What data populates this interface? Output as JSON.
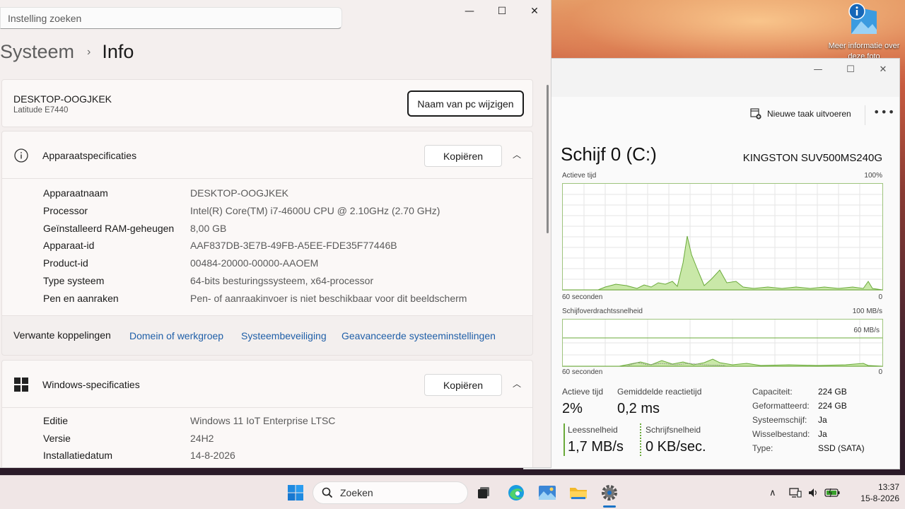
{
  "desktop": {
    "icon_label": "Meer informatie over deze foto"
  },
  "settings": {
    "search_placeholder": "Instelling zoeken",
    "breadcrumb_parent": "Systeem",
    "breadcrumb_current": "Info",
    "pc_name": "DESKTOP-OOGJKEK",
    "pc_model": "Latitude E7440",
    "rename_button": "Naam van pc wijzigen",
    "device_specs": {
      "title": "Apparaatspecificaties",
      "copy_button": "Kopiëren",
      "rows": [
        {
          "key": "Apparaatnaam",
          "value": "DESKTOP-OOGJKEK"
        },
        {
          "key": "Processor",
          "value": "Intel(R) Core(TM) i7-4600U CPU @ 2.10GHz (2.70 GHz)"
        },
        {
          "key": "Geïnstalleerd RAM-geheugen",
          "value": "8,00 GB"
        },
        {
          "key": "Apparaat-id",
          "value": "AAF837DB-3E7B-49FB-A5EE-FDE35F77446B"
        },
        {
          "key": "Product-id",
          "value": "00484-20000-00000-AAOEM"
        },
        {
          "key": "Type systeem",
          "value": "64-bits besturingssysteem, x64-processor"
        },
        {
          "key": "Pen en aanraken",
          "value": "Pen- of aanraakinvoer is niet beschikbaar voor dit beeldscherm"
        }
      ]
    },
    "related": {
      "label": "Verwante koppelingen",
      "links": [
        "Domein of werkgroep",
        "Systeembeveiliging",
        "Geavanceerde systeeminstellingen"
      ]
    },
    "windows_specs": {
      "title": "Windows-specificaties",
      "copy_button": "Kopiëren",
      "rows": [
        {
          "key": "Editie",
          "value": "Windows 11 IoT Enterprise LTSC"
        },
        {
          "key": "Versie",
          "value": "24H2"
        },
        {
          "key": "Installatiedatum",
          "value": "14-8-2026"
        }
      ]
    }
  },
  "taskmanager": {
    "new_task": "Nieuwe taak uitvoeren",
    "disk_title": "Schijf 0 (C:)",
    "model": "KINGSTON SUV500MS240G",
    "graph1": {
      "label": "Actieve tijd",
      "max": "100%",
      "xlabel": "60 seconden",
      "min": "0"
    },
    "graph2": {
      "label": "Schijfoverdrachtssnelheid",
      "max": "100 MB/s",
      "mid": "60 MB/s",
      "xlabel": "60 seconden",
      "min": "0"
    },
    "stats": {
      "active_label": "Actieve tijd",
      "active_value": "2%",
      "resp_label": "Gemiddelde reactietijd",
      "resp_value": "0,2 ms",
      "read_label": "Leessnelheid",
      "read_value": "1,7 MB/s",
      "write_label": "Schrijfsnelheid",
      "write_value": "0 KB/sec."
    },
    "props": [
      {
        "key": "Capaciteit:",
        "value": "224 GB"
      },
      {
        "key": "Geformatteerd:",
        "value": "224 GB"
      },
      {
        "key": "Systeemschijf:",
        "value": "Ja"
      },
      {
        "key": "Wisselbestand:",
        "value": "Ja"
      },
      {
        "key": "Type:",
        "value": "SSD (SATA)"
      }
    ]
  },
  "taskbar": {
    "search_label": "Zoeken",
    "time": "13:37",
    "date": "15-8-2026"
  },
  "colors": {
    "accent": "#1a73c6",
    "link": "#1f5fa8",
    "graph_line": "#6aaa3a",
    "graph_fill": "#c9e8a8"
  }
}
